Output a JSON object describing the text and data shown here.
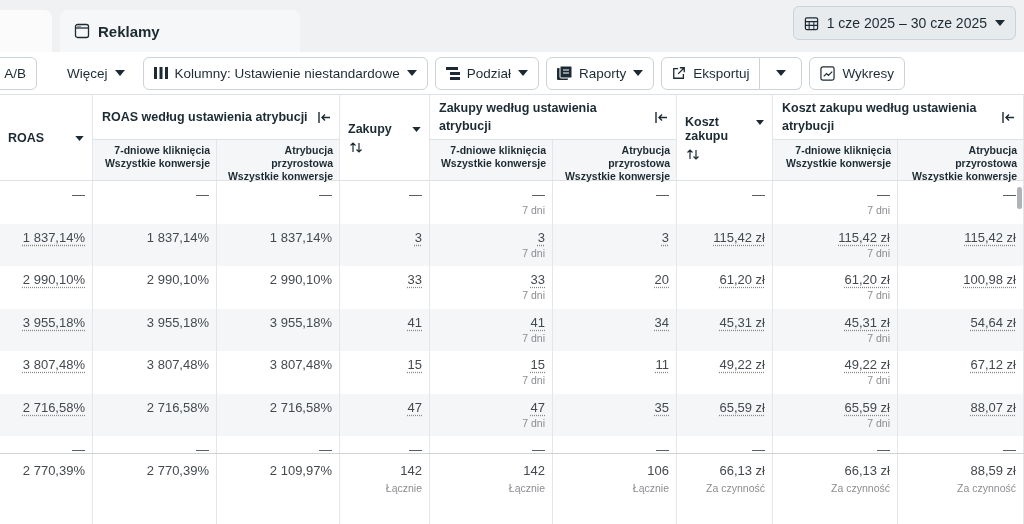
{
  "tabs": [
    {
      "selected": false
    },
    {
      "label": "Reklamy",
      "selected": true
    }
  ],
  "date_range": "1 cze 2025 – 30 cze 2025",
  "toolbar": [
    {
      "kind": "plain",
      "label": "A/B"
    },
    {
      "kind": "menu",
      "label": "Więcej"
    },
    {
      "kind": "columns",
      "label": "Kolumny: Ustawienie niestandardowe"
    },
    {
      "kind": "breakdown",
      "label": "Podział"
    },
    {
      "kind": "reports",
      "label": "Raporty"
    },
    {
      "kind": "export",
      "label": "Eksportuj"
    },
    {
      "kind": "charts",
      "label": "Wykresy"
    }
  ],
  "columns": [
    {
      "kind": "single",
      "label": "ROAS",
      "sortable": false
    },
    {
      "kind": "group",
      "label": "ROAS według ustawienia atrybucji",
      "subs": [
        "7-dniowe kliknięcia\nWszystkie konwersje",
        "Atrybucja\nprzyrostowa\nWszystkie konwersje"
      ]
    },
    {
      "kind": "single",
      "label": "Zakupy",
      "sortable": true
    },
    {
      "kind": "group",
      "label": "Zakupy według ustawienia atrybucji",
      "subs": [
        "7-dniowe kliknięcia\nWszystkie konwersje",
        "Atrybucja\nprzyrostowa\nWszystkie konwersje"
      ]
    },
    {
      "kind": "single",
      "label": "Koszt zakupu",
      "sortable": true
    },
    {
      "kind": "group",
      "label": "Koszt zakupu według ustawienia atrybucji",
      "subs": [
        "7-dniowe kliknięcia\nWszystkie konwersje",
        "Atrybucja\nprzyrostowa\nWszystkie konwersje"
      ]
    }
  ],
  "rows": [
    {
      "cells": [
        {
          "value": "—",
          "underlined": false
        },
        {
          "value": "—",
          "underlined": false
        },
        {
          "value": "—",
          "underlined": false
        },
        {
          "value": "—",
          "underlined": false
        },
        {
          "value": "—",
          "sub": "7 dni",
          "underlined": false
        },
        {
          "value": "—",
          "underlined": false
        },
        {
          "value": "—",
          "underlined": false
        },
        {
          "value": "—",
          "sub": "7 dni",
          "underlined": false
        },
        {
          "value": "—",
          "underlined": false
        }
      ]
    },
    {
      "cells": [
        {
          "value": "1 837,14%",
          "underlined": true
        },
        {
          "value": "1 837,14%",
          "underlined": false
        },
        {
          "value": "1 837,14%",
          "underlined": false
        },
        {
          "value": "3",
          "underlined": true
        },
        {
          "value": "3",
          "sub": "7 dni",
          "underlined": true
        },
        {
          "value": "3",
          "underlined": true
        },
        {
          "value": "115,42 zł",
          "underlined": true
        },
        {
          "value": "115,42 zł",
          "sub": "7 dni",
          "underlined": true
        },
        {
          "value": "115,42 zł",
          "underlined": true
        }
      ]
    },
    {
      "cells": [
        {
          "value": "2 990,10%",
          "underlined": true
        },
        {
          "value": "2 990,10%",
          "underlined": false
        },
        {
          "value": "2 990,10%",
          "underlined": false
        },
        {
          "value": "33",
          "underlined": true
        },
        {
          "value": "33",
          "sub": "7 dni",
          "underlined": true
        },
        {
          "value": "20",
          "underlined": true
        },
        {
          "value": "61,20 zł",
          "underlined": true
        },
        {
          "value": "61,20 zł",
          "sub": "7 dni",
          "underlined": true
        },
        {
          "value": "100,98 zł",
          "underlined": true
        }
      ]
    },
    {
      "cells": [
        {
          "value": "3 955,18%",
          "underlined": true
        },
        {
          "value": "3 955,18%",
          "underlined": false
        },
        {
          "value": "3 955,18%",
          "underlined": false
        },
        {
          "value": "41",
          "underlined": true
        },
        {
          "value": "41",
          "sub": "7 dni",
          "underlined": true
        },
        {
          "value": "34",
          "underlined": true
        },
        {
          "value": "45,31 zł",
          "underlined": true
        },
        {
          "value": "45,31 zł",
          "sub": "7 dni",
          "underlined": true
        },
        {
          "value": "54,64 zł",
          "underlined": true
        }
      ]
    },
    {
      "cells": [
        {
          "value": "3 807,48%",
          "underlined": true
        },
        {
          "value": "3 807,48%",
          "underlined": false
        },
        {
          "value": "3 807,48%",
          "underlined": false
        },
        {
          "value": "15",
          "underlined": true
        },
        {
          "value": "15",
          "sub": "7 dni",
          "underlined": true
        },
        {
          "value": "11",
          "underlined": true
        },
        {
          "value": "49,22 zł",
          "underlined": true
        },
        {
          "value": "49,22 zł",
          "sub": "7 dni",
          "underlined": true
        },
        {
          "value": "67,12 zł",
          "underlined": true
        }
      ]
    },
    {
      "cells": [
        {
          "value": "2 716,58%",
          "underlined": true
        },
        {
          "value": "2 716,58%",
          "underlined": false
        },
        {
          "value": "2 716,58%",
          "underlined": false
        },
        {
          "value": "47",
          "underlined": true
        },
        {
          "value": "47",
          "sub": "7 dni",
          "underlined": true
        },
        {
          "value": "35",
          "underlined": true
        },
        {
          "value": "65,59 zł",
          "underlined": true
        },
        {
          "value": "65,59 zł",
          "sub": "7 dni",
          "underlined": true
        },
        {
          "value": "88,07 zł",
          "underlined": true
        }
      ]
    },
    {
      "cells": [
        {
          "value": "—"
        },
        {
          "value": "—"
        },
        {
          "value": "—"
        },
        {
          "value": "—"
        },
        {
          "value": "—"
        },
        {
          "value": "—"
        },
        {
          "value": "—"
        },
        {
          "value": "—"
        },
        {
          "value": "—"
        }
      ]
    }
  ],
  "totals": [
    {
      "value": "2 770,39%"
    },
    {
      "value": "2 770,39%"
    },
    {
      "value": "2 109,97%"
    },
    {
      "value": "142",
      "sub": "Łącznie"
    },
    {
      "value": "142",
      "sub": "Łącznie"
    },
    {
      "value": "106",
      "sub": "Łącznie"
    },
    {
      "value": "66,13 zł",
      "sub": "Za czynność"
    },
    {
      "value": "66,13 zł",
      "sub": "Za czynność"
    },
    {
      "value": "88,59 zł",
      "sub": "Za czynność"
    }
  ]
}
